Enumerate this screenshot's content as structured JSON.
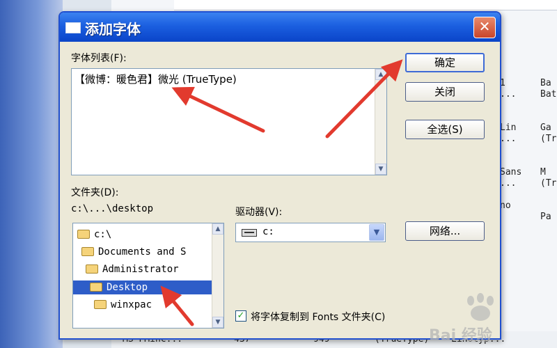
{
  "dialog": {
    "title": "添加字体",
    "close_glyph": "✕",
    "font_list_label": "字体列表(F):",
    "font_list_items": [
      "【微博：暖色君】微光 (TrueType)"
    ],
    "folder_label": "文件夹(D):",
    "current_path": "c:\\...\\desktop",
    "drives_label": "驱动器(V):",
    "drive_value": "c:",
    "folders": [
      {
        "label": "c:\\",
        "selected": false
      },
      {
        "label": "Documents and S",
        "selected": false
      },
      {
        "label": "Administrator",
        "selected": false
      },
      {
        "label": "Desktop",
        "selected": true
      },
      {
        "label": "winxpac",
        "selected": false
      }
    ],
    "buttons": {
      "ok": "确定",
      "close": "关闭",
      "select_all": "全选(S)",
      "network": "网络..."
    },
    "copy_checkbox": {
      "label": "将字体复制到 Fonts 文件夹(C)",
      "checked": true
    }
  },
  "background": {
    "col1_lines": [
      "1",
      "...",
      "",
      "",
      "Lin",
      "...",
      "",
      "",
      "Sans",
      "...",
      "",
      "no"
    ],
    "col2_lines": [
      "Ba",
      "Bat",
      "",
      "",
      "Ga",
      "(Tr",
      "",
      "",
      "M",
      "(Tr",
      "",
      "",
      "Pa"
    ],
    "bottom_row": [
      "MS PMinc...",
      "437",
      "949",
      "(TrueType)",
      "Linotyp..."
    ]
  },
  "watermark": {
    "text": "Bai 经验"
  },
  "colors": {
    "titlebar": "#1b5fe0",
    "selection": "#2e5dc8",
    "arrow": "#e23a2e"
  }
}
